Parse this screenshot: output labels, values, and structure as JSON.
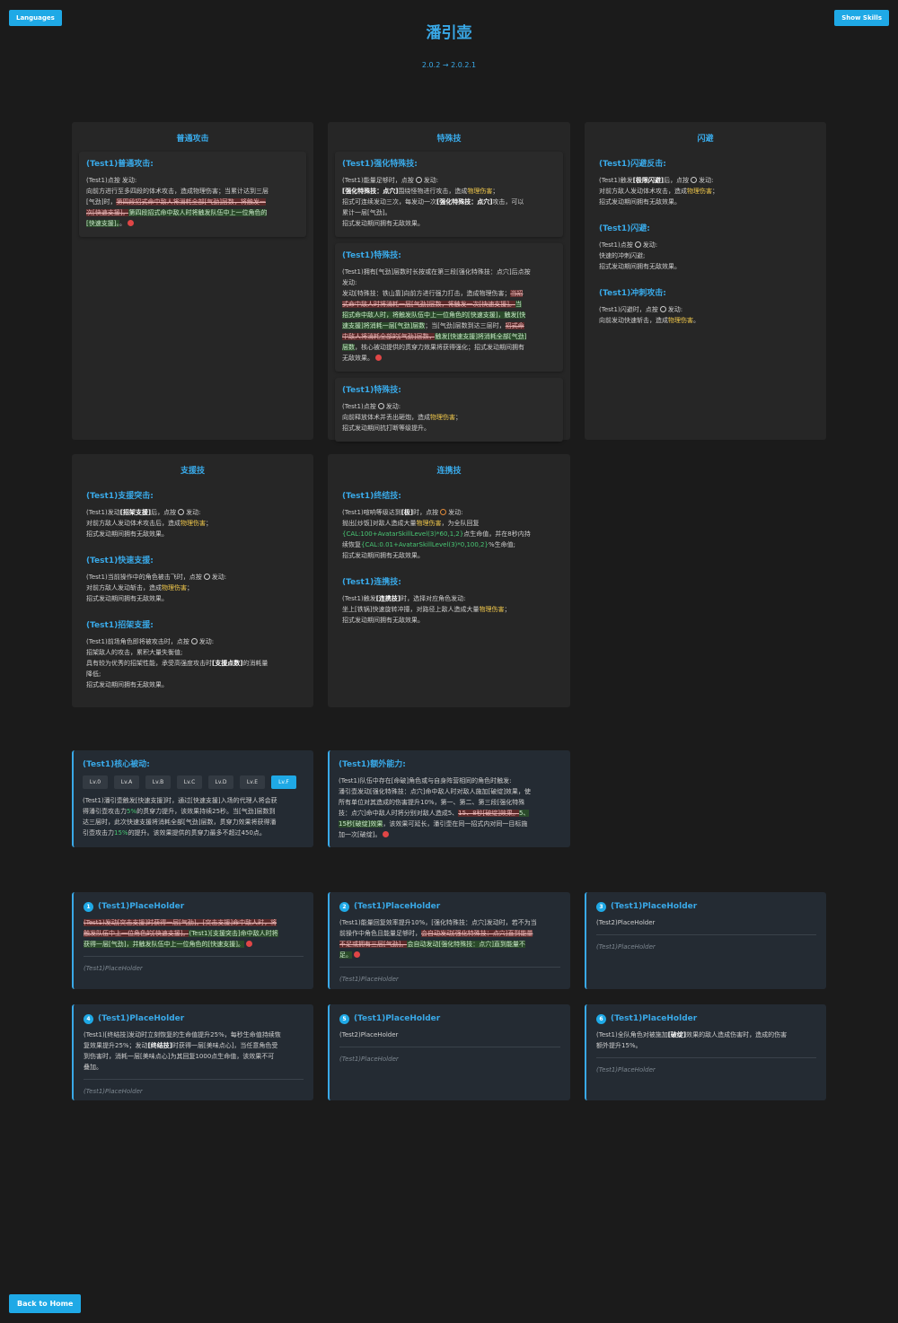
{
  "header": {
    "languages_button": "Languages",
    "show_skills_button": "Show Skills",
    "title": "潘引壶",
    "version": "2.0.2 → 2.0.2.1"
  },
  "footer": {
    "back_button": "Back to Home"
  },
  "columns": {
    "basic": {
      "title": "普通攻击",
      "s1": {
        "name": "(Test1)普通攻击:",
        "l1": "(Test1)点按 发动:",
        "l2": "向前方进行至多四段的体术攻击，造成物理伤害；当累计达到三层",
        "l3a": "[气劲]时，",
        "l3d": "第四段招式命中敌人将消耗全部[气劲]层数，将触发一",
        "l4d": "次[快速支援]。",
        "l4i": "第四段招式命中敌人时将触发队伍中上一位角色的",
        "l5i": "[快速支援]。",
        "l5b": "。"
      }
    },
    "special": {
      "title": "特殊技",
      "s1": {
        "name": "(Test1)强化特殊技:",
        "l1a": "(Test1)能量足够时，点按",
        "l1b": "发动:",
        "l2a": "[强化特殊技：点穴]",
        "l2b": "围绕怪物进行攻击，造成",
        "l2c": "物理伤害",
        "l2d": "；",
        "l3a": "招式可连续发动三次，每发动一次",
        "l3b": "[强化特殊技：点穴]",
        "l3c": "攻击，可以",
        "l4": "累计一层[气劲]。",
        "l5": "招式发动期间拥有无敌效果。"
      },
      "s2": {
        "name": "(Test1)特殊技:",
        "l1": "(Test1)拥有[气劲]层数时长按或在第三段[强化特殊技：点穴]后点按",
        "l2": "发动:",
        "l3a": "发动[特殊技：铁山靠]向前方进行强力打击，造成物理伤害；",
        "l3d": "当招",
        "l4d": "式命中敌人时将消耗一层[气劲]层数，将触发一次[快速支援]。",
        "l4i": "当",
        "l5i": "招式命中敌人时，将触发队伍中上一位角色的[快速支援]，触发[快",
        "l6i": "速支援]将消耗一层[气劲]层数",
        "l6a": "；当[气劲]层数到达三层时，",
        "l6d": "招式命",
        "l7d": "中敌人将消耗全部的[气劲]层数，",
        "l7i": "触发[快速支援]将消耗全部[气劲]",
        "l8i": "层数",
        "l8a": "，核心被动提供的贯穿力效果将获得强化；招式发动期间拥有",
        "l9": "无敌效果。"
      },
      "s3": {
        "name": "(Test1)特殊技:",
        "l1a": "(Test1)点按",
        "l1b": "发动:",
        "l2a": "向前释放体术并丢出砸炮，造成",
        "l2b": "物理伤害",
        "l2c": "；",
        "l3": "招式发动期间抗打断等级提升。"
      }
    },
    "dodge": {
      "title": "闪避",
      "s1": {
        "name": "(Test1)闪避反击:",
        "l1a": "(Test1)触发",
        "l1b": "[极限闪避]",
        "l1c": "后，点按",
        "l1d": "发动:",
        "l2a": "对前方敌人发动体术攻击，造成",
        "l2b": "物理伤害",
        "l2c": "；",
        "l3": "招式发动期间拥有无敌效果。"
      },
      "s2": {
        "name": "(Test1)闪避:",
        "l1a": "(Test1)点按",
        "l1b": "发动:",
        "l2": "快速的冲刺闪避;",
        "l3": "招式发动期间拥有无敌效果。"
      },
      "s3": {
        "name": "(Test1)冲刺攻击:",
        "l1a": "(Test1)闪避时，点按",
        "l1b": "发动:",
        "l2a": "向前发动快速斩击，造成",
        "l2b": "物理伤害",
        "l2c": "。"
      }
    },
    "assist": {
      "title": "支援技",
      "s1": {
        "name": "(Test1)支援突击:",
        "l1a": "(Test1)发动",
        "l1b": "[招架支援]",
        "l1c": "后，点按",
        "l1d": "发动:",
        "l2a": "对前方敌人发动体术攻击后，造成",
        "l2b": "物理伤害",
        "l2c": "；",
        "l3": "招式发动期间拥有无敌效果。"
      },
      "s2": {
        "name": "(Test1)快速支援:",
        "l1a": "(Test1)当前操作中的角色被击飞时，点按",
        "l1b": "发动:",
        "l2a": "对前方敌人发动斩击，造成",
        "l2b": "物理伤害",
        "l2c": "；",
        "l3": "招式发动期间拥有无敌效果。"
      },
      "s3": {
        "name": "(Test1)招架支援:",
        "l1a": "(Test1)前场角色即将被攻击时，点按",
        "l1b": "发动:",
        "l2": "招架敌人的攻击，累积大量失衡值;",
        "l3a": "具有较为优秀的招架性能，承受高强度攻击时",
        "l3b": "[支援点数]",
        "l3c": "的消耗量",
        "l4": "降低;",
        "l5": "招式发动期间拥有无敌效果。"
      }
    },
    "chain": {
      "title": "连携技",
      "s1": {
        "name": "(Test1)终结技:",
        "l1a": "(Test1)喧响等级达到",
        "l1b": "[极]",
        "l1c": "时，点按",
        "l1d": "发动:",
        "l2a": "抛出[炒饭]对敌人造成大量",
        "l2b": "物理伤害",
        "l2c": "，为全队回复",
        "l3a": "{CAL:100+AvatarSkillLevel(3)*60,1,2}",
        "l3b": "点生命值，并在8秒内持",
        "l4a": "续恢复",
        "l4b": "{CAL:0.01+AvatarSkillLevel(3)*0,100,2}",
        "l4c": "%生命值;",
        "l5": "招式发动期间拥有无敌效果。"
      },
      "s2": {
        "name": "(Test1)连携技:",
        "l1a": "(Test1)触发",
        "l1b": "[连携技]",
        "l1c": "时，选择对应角色发动:",
        "l2a": "坐上[铁锅]快速旋转冲撞，对路径上敌人造成大量",
        "l2b": "物理伤害",
        "l2c": "；",
        "l3": "招式发动期间拥有无敌效果。"
      }
    }
  },
  "core": {
    "title": "(Test1)核心被动:",
    "levels": [
      "Lv.0",
      "Lv.A",
      "Lv.B",
      "Lv.C",
      "Lv.D",
      "Lv.E",
      "Lv.F"
    ],
    "active_level": "Lv.F",
    "l1": "(Test1)潘引壶触发[快速支援]时，通过[快速支援]入场的代理人将会获",
    "l2a": "得潘引壶攻击力",
    "l2b": "5%",
    "l2c": "的贯穿力提升，该效果持续25秒。当[气劲]层数到",
    "l3": "达三层时，此次快速支援将消耗全部[气劲]层数，贯穿力效果将获得潘",
    "l4a": "引壶攻击力",
    "l4b": "15%",
    "l4c": "的提升。该效果提供的贯穿力最多不超过450点。"
  },
  "extra": {
    "title": "(Test1)额外能力:",
    "l1": "(Test1)队伍中存在[命破]角色或与自身阵营相同的角色时触发:",
    "l2": "潘引壶发动[强化特殊技：点穴]命中敌人时对敌人施加[破绽]效果，使",
    "l3": "所有单位对其造成的伤害提升10%，第一、第二、第三段[强化特殊",
    "l4a": "技：点穴]命中敌人时将分别对敌人造成5、",
    "l4d": "15、8秒[破绽]效果。",
    "l4i": "5、",
    "l5i": "15秒[破绽]效果",
    "l5a": "，该效果可延长，潘引壶在同一招式内对同一目标施",
    "l6": "加一次[破绽]。"
  },
  "eidolons": [
    {
      "num": "1",
      "name": "(Test1)PlaceHolder",
      "l1d": "(Test1)发动[突击支援]时获得一层[气劲]。[突击支援]命中敌人时，将",
      "l2d": "触发队伍中上一位角色的[快速支援]。",
      "l2i": "(Test1)[支援突击]命中敌人时将",
      "l3i": "获得一层[气劲]，并触发队伍中上一位角色的[快速支援]。",
      "foot": "(Test1)PlaceHolder"
    },
    {
      "num": "2",
      "name": "(Test1)PlaceHolder",
      "l1": "(Test1)能量回复效率提升10%，[强化特殊技：点穴]发动时，若不为当",
      "l2a": "前操作中角色且能量足够时，",
      "l2d": "会自动发动[强化特殊技：点穴]直到能量",
      "l3d": "不足或拥有三层[气劲]。",
      "l3i": "会自动发动[强化特殊技：点穴]直到能量不",
      "l4i": "足。",
      "foot": "(Test1)PlaceHolder"
    },
    {
      "num": "3",
      "name": "(Test1)PlaceHolder",
      "l1": "(Test2)PlaceHolder",
      "foot": "(Test1)PlaceHolder"
    },
    {
      "num": "4",
      "name": "(Test1)PlaceHolder",
      "l1": "(Test1)[终结技]发动时立刻恢复的生命值提升25%，每秒生命值持续恢",
      "l2a": "复效果提升25%；发动",
      "l2b": "[终结技]",
      "l2c": "时获得一层[美味点心]，当任意角色受",
      "l3": "到伤害时，消耗一层[美味点心]为其回复1000点生命值，该效果不可",
      "l4": "叠加。",
      "foot": "(Test1)PlaceHolder"
    },
    {
      "num": "5",
      "name": "(Test1)PlaceHolder",
      "l1": "(Test2)PlaceHolder",
      "foot": "(Test1)PlaceHolder"
    },
    {
      "num": "6",
      "name": "(Test1)PlaceHolder",
      "l1a": "(Test1)全队角色对被施加",
      "l1b": "[破绽]",
      "l1c": "效果的敌人造成伤害时，造成的伤害",
      "l2": "额外提升15%。",
      "foot": "(Test1)PlaceHolder"
    }
  ],
  "colors": {
    "accent": "#39a9e8",
    "button": "#1fa9e6",
    "background": "#1b1b1b",
    "damage": "#f2c94c",
    "formula": "#48c774",
    "removed": "#5c2a2a",
    "added": "#2a4a2a"
  },
  "icons": {
    "alert": "alert-dot-icon",
    "button": "button-glyph-icon"
  }
}
